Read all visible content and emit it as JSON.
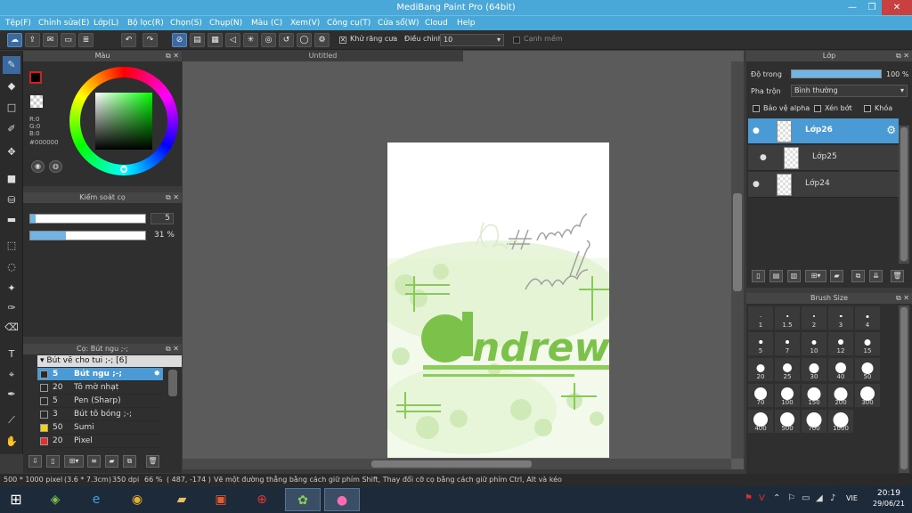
{
  "window": {
    "title": "MediBang Paint Pro (64bit)",
    "min": "—",
    "max": "❐",
    "close": "✕"
  },
  "menu": [
    "Tệp(F)",
    "Chỉnh sửa(E)",
    "Lớp(L)",
    "Bộ lọc(R)",
    "Chọn(S)",
    "Chụp(N)",
    "Màu (C)",
    "Xem(V)",
    "Công cụ(T)",
    "Cửa sổ(W)",
    "Cloud",
    "Help"
  ],
  "toolbar": {
    "antialias_label": "Khử răng cưa",
    "antialias_checked": "✕",
    "adjust_label": "Điều chỉnh",
    "adjust_value": "10",
    "edge_label": "Cạnh mềm"
  },
  "color_panel": {
    "title": "Màu",
    "r": "R:0",
    "g": "G:0",
    "b": "B:0",
    "hex": "#000000"
  },
  "brush_control": {
    "title": "Kiểm soát cọ",
    "size_value": "5",
    "size_fraction": 0.05,
    "opacity_value": "31 %",
    "opacity_fraction": 0.31
  },
  "brush_panel": {
    "title": "Cọ: Bút ngu ;-;",
    "group": "Bút vẽ cho tui ;-; [6]",
    "items": [
      {
        "size": "5",
        "name": "Bút ngu ;-;",
        "color": "#2a2a2a",
        "selected": true
      },
      {
        "size": "20",
        "name": "Tô mờ nhạt",
        "color": "#2a2a2a",
        "selected": false
      },
      {
        "size": "5",
        "name": "Pen (Sharp)",
        "color": "#2a2a2a",
        "selected": false
      },
      {
        "size": "3",
        "name": "Bút tô bóng ;-;",
        "color": "#2a2a2a",
        "selected": false
      },
      {
        "size": "50",
        "name": "Sumi",
        "color": "#f2d21b",
        "selected": false
      },
      {
        "size": "20",
        "name": "Pixel",
        "color": "#e03030",
        "selected": false
      }
    ]
  },
  "canvas": {
    "tab": "Untitled"
  },
  "layer_panel": {
    "title": "Lớp",
    "opacity_label": "Độ trong",
    "opacity_value": "100 %",
    "blend_label": "Pha trộn",
    "blend_value": "Bình thường",
    "protect_alpha": "Bảo vệ alpha",
    "clipping": "Xén bớt",
    "lock": "Khóa",
    "layers": [
      {
        "name": "Lớp26",
        "selected": true
      },
      {
        "name": "Lớp25",
        "selected": false
      },
      {
        "name": "Lớp24",
        "selected": false
      }
    ]
  },
  "brush_size_panel": {
    "title": "Brush Size",
    "sizes": [
      "1",
      "1.5",
      "2",
      "3",
      "4",
      "5",
      "7",
      "10",
      "12",
      "15",
      "20",
      "25",
      "30",
      "40",
      "50",
      "70",
      "100",
      "150",
      "200",
      "300",
      "400",
      "500",
      "700",
      "1000"
    ]
  },
  "status": {
    "image_size": "500 * 1000 pixel",
    "physical": "(3.6 * 7.3cm)",
    "dpi": "350 dpi",
    "zoom": "66 %",
    "coords": "( 487, -174 )",
    "hint": "Vẽ một đường thẳng bằng cách giữ phím Shift, Thay đổi cỡ cọ bằng cách giữ phím Ctrl, Alt và kéo"
  },
  "taskbar": {
    "lang": "VIE",
    "time": "20:19",
    "date": "29/06/21"
  },
  "colors": {
    "accent": "#4aa8d8",
    "selected": "#4a9ad6",
    "panel": "#2f2f2f",
    "drawing_green": "#7cc24a"
  }
}
